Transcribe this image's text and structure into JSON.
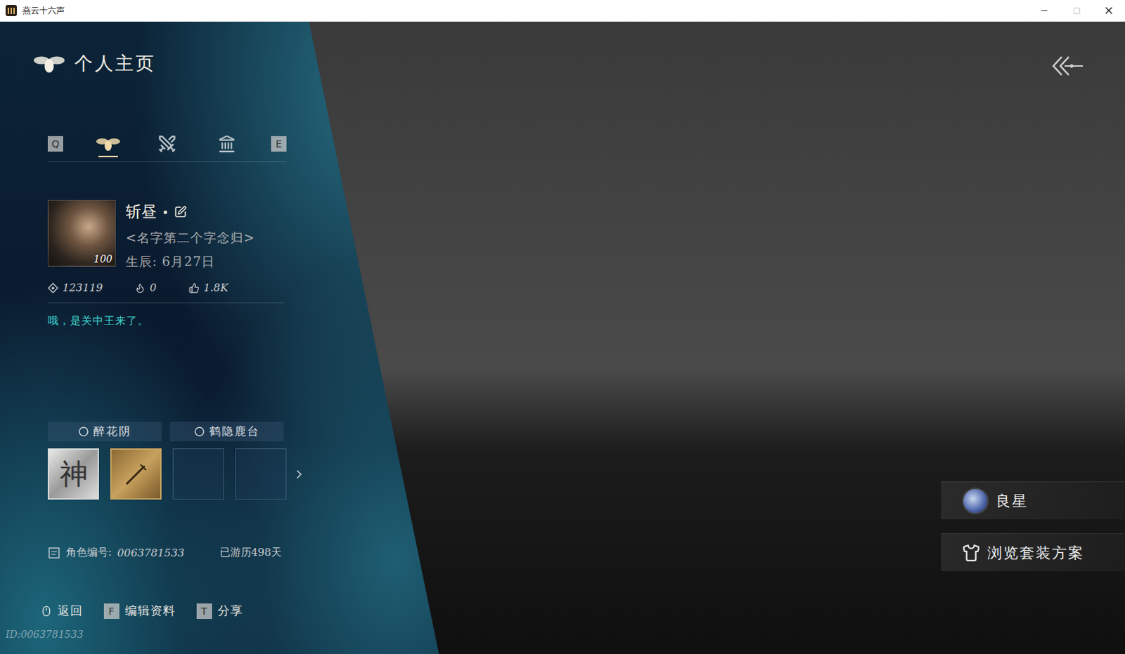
{
  "window": {
    "title": "燕云十六声"
  },
  "page": {
    "title": "个人主页"
  },
  "tabs": {
    "prev_key": "Q",
    "next_key": "E",
    "items": [
      {
        "kind": "profile",
        "selected": true
      },
      {
        "kind": "combat",
        "selected": false
      },
      {
        "kind": "gate",
        "selected": false
      }
    ]
  },
  "profile": {
    "name": "斩昼",
    "level": "100",
    "title": "<名字第二个字念归>",
    "birthday": "生辰: 6月27日",
    "stats": [
      {
        "kind": "coin",
        "value": "123119"
      },
      {
        "kind": "fire",
        "value": "0"
      },
      {
        "kind": "like",
        "value": "1.8K"
      }
    ],
    "bio": "哦，是关中王来了。"
  },
  "tags": [
    "醉花阴",
    "鹤隐鹿台"
  ],
  "badges": [
    {
      "kind": "silver",
      "filled": true,
      "text": "神"
    },
    {
      "kind": "gold",
      "filled": true,
      "text": ""
    },
    {
      "kind": "empty",
      "filled": false,
      "text": ""
    },
    {
      "kind": "empty",
      "filled": false,
      "text": ""
    }
  ],
  "info": {
    "role_id_label": "角色编号:",
    "role_id": "0063781533",
    "days": "已游历498天"
  },
  "footer": [
    {
      "kind": "mouse",
      "key": "",
      "label": "返回"
    },
    {
      "kind": "key",
      "key": "F",
      "label": "编辑资料"
    },
    {
      "kind": "key",
      "key": "T",
      "label": "分享"
    }
  ],
  "watermark": "ID:0063781533",
  "side_buttons": [
    {
      "kind": "avatar",
      "label": "良星"
    },
    {
      "kind": "outfit",
      "label": "浏览套装方案"
    }
  ]
}
